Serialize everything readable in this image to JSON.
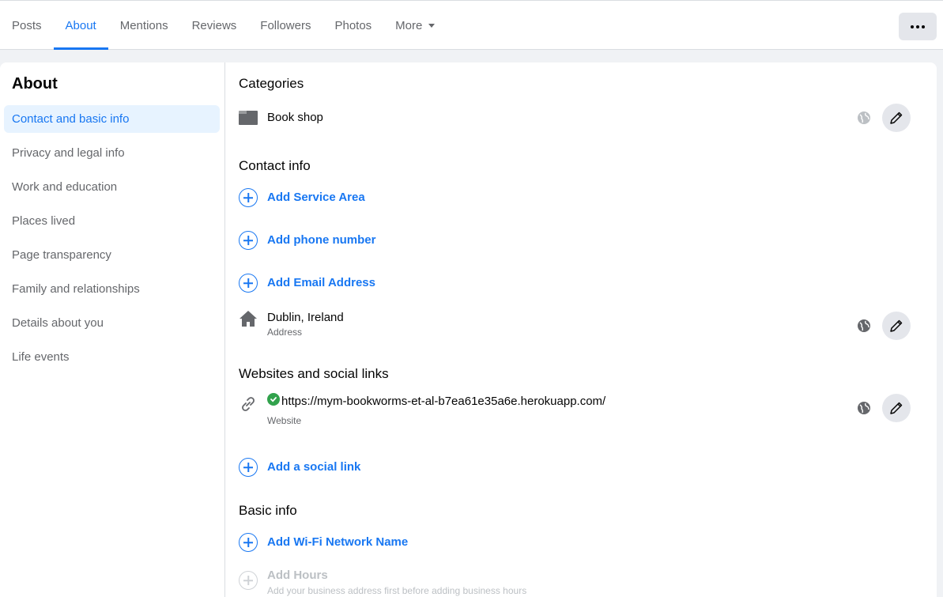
{
  "tabs": [
    {
      "label": "Posts"
    },
    {
      "label": "About"
    },
    {
      "label": "Mentions"
    },
    {
      "label": "Reviews"
    },
    {
      "label": "Followers"
    },
    {
      "label": "Photos"
    },
    {
      "label": "More"
    }
  ],
  "sidebar": {
    "title": "About",
    "items": [
      {
        "label": "Contact and basic info"
      },
      {
        "label": "Privacy and legal info"
      },
      {
        "label": "Work and education"
      },
      {
        "label": "Places lived"
      },
      {
        "label": "Page transparency"
      },
      {
        "label": "Family and relationships"
      },
      {
        "label": "Details about you"
      },
      {
        "label": "Life events"
      }
    ]
  },
  "categories": {
    "title": "Categories",
    "value": "Book shop"
  },
  "contact": {
    "title": "Contact info",
    "add_service_area": "Add Service Area",
    "add_phone": "Add phone number",
    "add_email": "Add Email Address",
    "address_value": "Dublin, Ireland",
    "address_label": "Address"
  },
  "websites": {
    "title": "Websites and social links",
    "url": "https://mym-bookworms-et-al-b7ea61e35a6e.herokuapp.com/",
    "url_label": "Website",
    "add_social": "Add a social link"
  },
  "basic": {
    "title": "Basic info",
    "add_wifi": "Add Wi-Fi Network Name",
    "add_hours": "Add Hours",
    "hours_hint": "Add your business address first before adding business hours"
  },
  "colors": {
    "accent": "#1877f2",
    "verified": "#31a24c",
    "muted": "#65676b"
  }
}
